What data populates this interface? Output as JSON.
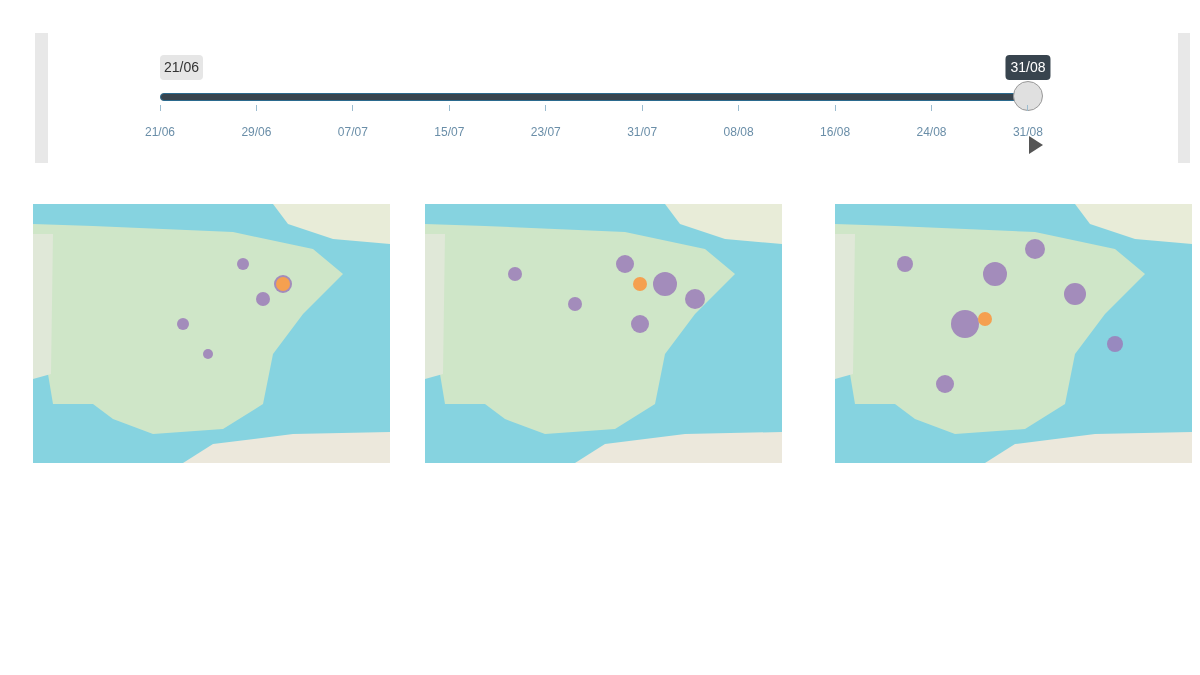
{
  "slider": {
    "min_label": "21/06",
    "value_label": "31/08",
    "level": 1,
    "ticks": [
      "21/06",
      "29/06",
      "07/07",
      "15/07",
      "23/07",
      "31/07",
      "08/08",
      "16/08",
      "24/08",
      "31/08"
    ]
  }
}
